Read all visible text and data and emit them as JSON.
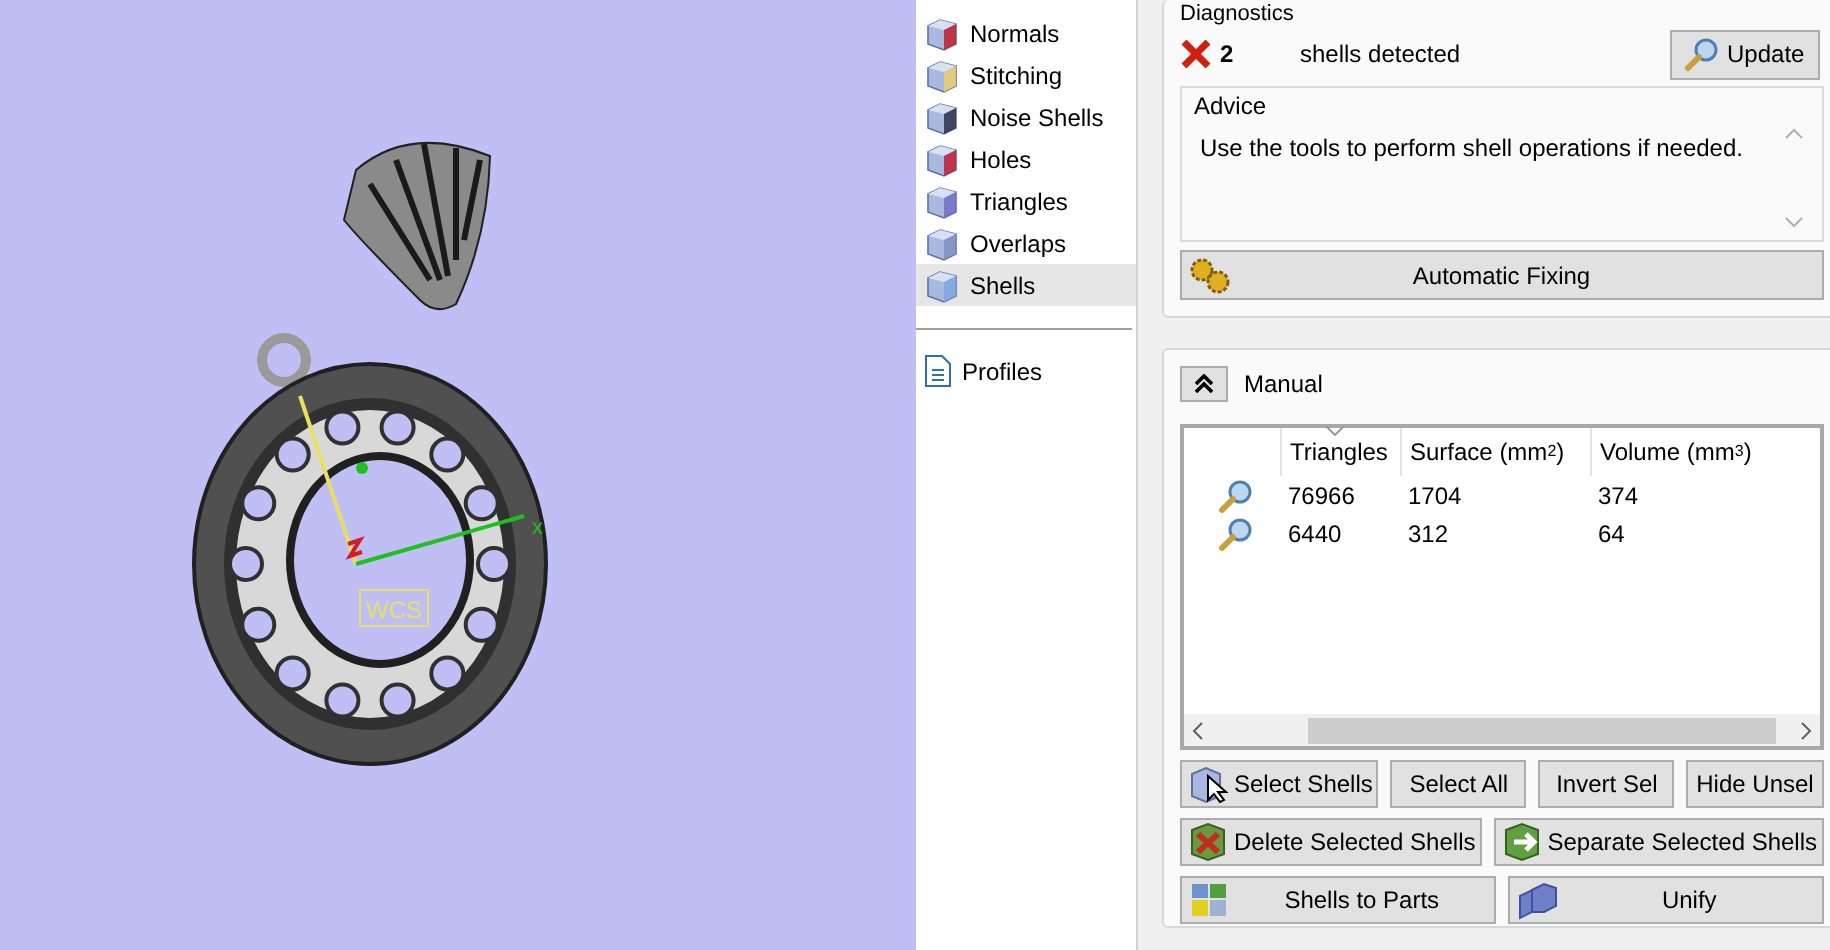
{
  "viewport": {
    "wcs_label": "WCS",
    "x_axis_label": "x"
  },
  "sidebar": {
    "items": [
      {
        "label": "Normals",
        "selected": false
      },
      {
        "label": "Stitching",
        "selected": false
      },
      {
        "label": "Noise Shells",
        "selected": false
      },
      {
        "label": "Holes",
        "selected": false
      },
      {
        "label": "Triangles",
        "selected": false
      },
      {
        "label": "Overlaps",
        "selected": false
      },
      {
        "label": "Shells",
        "selected": true
      }
    ],
    "profiles": {
      "label": "Profiles"
    }
  },
  "diagnostics": {
    "title": "Diagnostics",
    "has_errors": true,
    "count": "2",
    "message": "shells detected",
    "update_button": "Update"
  },
  "advice": {
    "title": "Advice",
    "text": "Use the tools to perform shell operations if needed."
  },
  "automatic_fixing_button": "Automatic Fixing",
  "manual": {
    "title": "Manual",
    "expanded": true,
    "table": {
      "columns": [
        {
          "label": "Triangles",
          "sorted": true
        },
        {
          "label": "Surface (mm$^{2}$)",
          "sorted": false
        },
        {
          "label": "Volume (mm$^{3}$)",
          "sorted": false
        }
      ],
      "rows": [
        [
          "76966",
          "1704",
          "374"
        ],
        [
          "6440",
          "312",
          "64"
        ]
      ]
    },
    "buttons": [
      [
        {
          "label": "Select Shells",
          "kind": "cursor"
        },
        {
          "label": "Select All",
          "kind": "plain"
        },
        {
          "label": "Invert Sel",
          "kind": "plain"
        },
        {
          "label": "Hide Unsel",
          "kind": "plain"
        }
      ],
      [
        {
          "label": "Delete Selected Shells",
          "kind": "delete"
        },
        {
          "label": "Separate Selected Shells",
          "kind": "separate"
        }
      ],
      [
        {
          "label": "Shells to Parts",
          "kind": "parts"
        },
        {
          "label": "Unify",
          "kind": "unify"
        }
      ]
    ]
  }
}
